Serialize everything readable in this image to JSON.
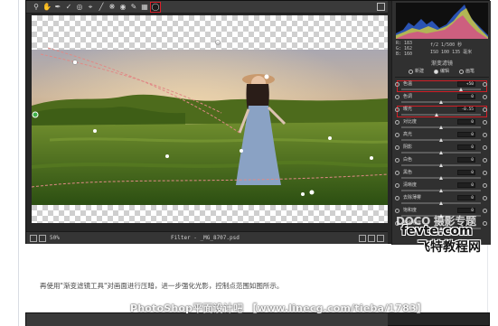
{
  "toolbar": {
    "icons": [
      "zoom-icon",
      "hand-icon",
      "white-balance-icon",
      "color-sampler-icon",
      "targeted-adjust-icon",
      "crop-icon",
      "straighten-icon",
      "spot-removal-icon",
      "red-eye-icon",
      "adjustment-brush-icon",
      "graduated-filter-icon",
      "radial-filter-icon"
    ],
    "active_tool": "radial-filter-icon"
  },
  "readout": {
    "r": "R:  183",
    "g": "G:  162",
    "b": "B:  160",
    "exposure": "f/2   1/500 秒",
    "iso": "ISO 100    135 毫米"
  },
  "panel": {
    "title": "渐变滤镜",
    "modes": [
      {
        "label": "新建",
        "selected": false
      },
      {
        "label": "编辑",
        "selected": true
      },
      {
        "label": "画笔",
        "selected": false
      }
    ],
    "sliders": [
      {
        "label": "色温",
        "value": "+50",
        "position": 0.76,
        "highlight": true
      },
      {
        "label": "色调",
        "value": "0",
        "position": 0.5
      },
      {
        "label": "曝光",
        "value": "-0.55",
        "position": 0.45,
        "highlight": true
      },
      {
        "label": "对比度",
        "value": "0",
        "position": 0.5
      },
      {
        "label": "高光",
        "value": "0",
        "position": 0.5
      },
      {
        "label": "阴影",
        "value": "0",
        "position": 0.5
      },
      {
        "label": "白色",
        "value": "0",
        "position": 0.5
      },
      {
        "label": "黑色",
        "value": "0",
        "position": 0.5
      },
      {
        "label": "清晰度",
        "value": "0",
        "position": 0.5
      },
      {
        "label": "去除薄雾",
        "value": "0",
        "position": 0.5
      },
      {
        "label": "饱和度",
        "value": "0",
        "position": 0.5
      },
      {
        "label": "锐化程度",
        "value": "0",
        "position": 0.5
      }
    ]
  },
  "statusbar": {
    "zoom": "50%",
    "filename": "Filter - _MG_8707.psd"
  },
  "watermark": {
    "line1": "DOCO 摄影专题",
    "line2": "fevte.com",
    "line3": "飞特教程网"
  },
  "caption": "再使用\"渐变滤镜工具\"对画面进行压暗，进一步强化光影，控制点范围如图所示。",
  "banner": "PhotoShop平面设计吧 【www.linecg.com/tieba/1783】",
  "colors": {
    "highlight": "#d01e26",
    "panel_bg": "#303030",
    "toolbar_bg": "#3a3a3a"
  }
}
